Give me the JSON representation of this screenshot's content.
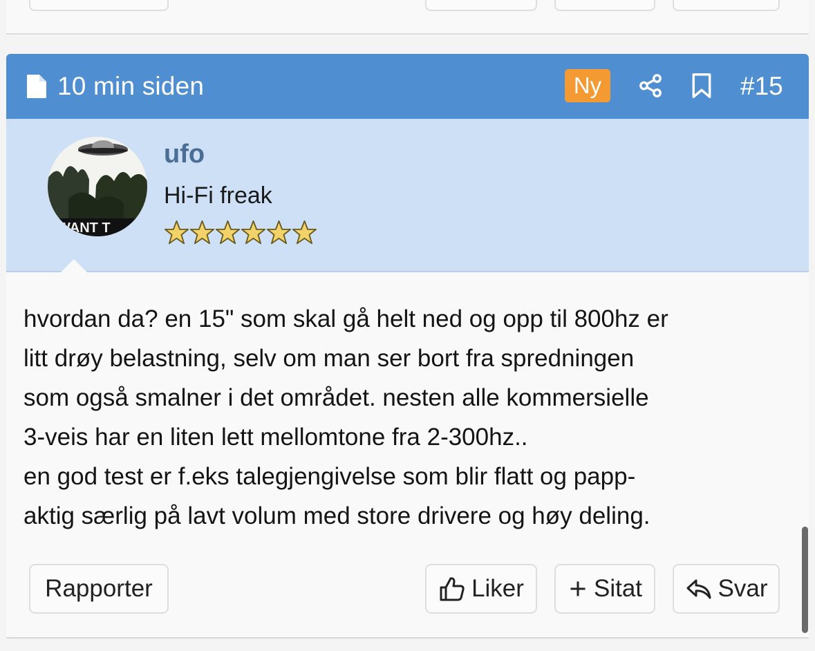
{
  "post": {
    "time": "10 min siden",
    "new_badge": "Ny",
    "number": "#15",
    "author": {
      "name": "ufo",
      "title": "Hi-Fi freak",
      "avatar_text": "WANT T",
      "star_count": 6
    },
    "message_lines": [
      "hvordan da? en 15\" som skal gå helt ned og opp til 800hz er",
      "litt drøy belastning, selv om man ser bort fra spredningen",
      "som også smalner i det området. nesten alle kommersielle",
      "3-veis har en liten lett mellomtone fra 2-300hz..",
      "en god test er f.eks talegjengivelse som blir flatt og papp-",
      "aktig særlig på lavt volum med store drivere og høy deling."
    ],
    "actions": {
      "report": "Rapporter",
      "like": "Liker",
      "quote": "Sitat",
      "reply": "Svar"
    }
  },
  "icons": {
    "time": "document-icon",
    "share": "share-icon",
    "bookmark": "bookmark-icon",
    "like": "thumbs-up-icon",
    "quote": "plus-icon",
    "reply": "reply-arrow-icon"
  },
  "colors": {
    "header_bg": "#4f8fd1",
    "user_panel_bg": "#cde0f5",
    "new_badge": "#f39b32",
    "username": "#4a6d96"
  }
}
